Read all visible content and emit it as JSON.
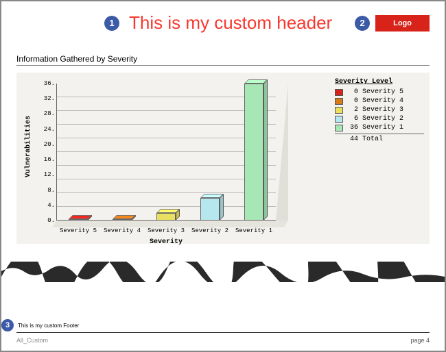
{
  "header": {
    "badge1": "1",
    "badge2": "2",
    "text": "This is my custom header",
    "logo_label": "Logo"
  },
  "section": {
    "title": "Information Gathered by Severity"
  },
  "chart_data": {
    "type": "bar",
    "categories": [
      "Severity 5",
      "Severity 4",
      "Severity 3",
      "Severity 2",
      "Severity 1"
    ],
    "values": [
      0,
      0,
      2,
      6,
      36
    ],
    "series_colors": [
      "#d8231a",
      "#d87a1a",
      "#e9df61",
      "#b6e6ee",
      "#a7e6b5"
    ],
    "title": "Information Gathered by Severity",
    "xlabel": "Severity",
    "ylabel": "Vulnerabilities",
    "ylim": [
      0,
      36
    ],
    "yticks": [
      0,
      4,
      8,
      12,
      16,
      20,
      24,
      28,
      32,
      36
    ],
    "legend_title": "Severity Level",
    "legend_total_label": "Total",
    "legend_total_value": 44
  },
  "footer": {
    "badge3": "3",
    "text": "This is my custom Footer",
    "filename": "All_Custom",
    "page_label": "page 4"
  }
}
